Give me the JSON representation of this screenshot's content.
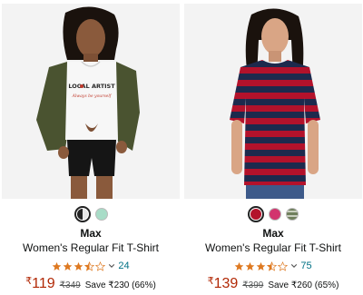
{
  "products": [
    {
      "brand": "Max",
      "title": "Women's Regular Fit T-Shirt",
      "rating_count": "24",
      "rating_value": 3.5,
      "price_symbol": "₹",
      "price": "119",
      "mrp": "₹349",
      "save": "Save ₹230 (66%)",
      "image_text_line1": "LOCAL ARTIST",
      "image_text_line2": "Always be yourself",
      "swatches": [
        {
          "color": "#222222",
          "split": "#e6e6e6",
          "selected": true
        },
        {
          "color": "#a8dcc7",
          "selected": false
        }
      ]
    },
    {
      "brand": "Max",
      "title": "Women's Regular Fit T-Shirt",
      "rating_count": "75",
      "rating_value": 3.5,
      "price_symbol": "₹",
      "price": "139",
      "mrp": "₹399",
      "save": "Save ₹260 (65%)",
      "swatches": [
        {
          "color": "#b3122b",
          "selected": true
        },
        {
          "color": "#d2346e",
          "selected": false
        },
        {
          "color": "#6f7f5c",
          "selected": false
        }
      ]
    }
  ],
  "colors": {
    "price": "#b12704",
    "link": "#007185",
    "star": "#de7921",
    "image_bg": "#f3f3f3"
  }
}
